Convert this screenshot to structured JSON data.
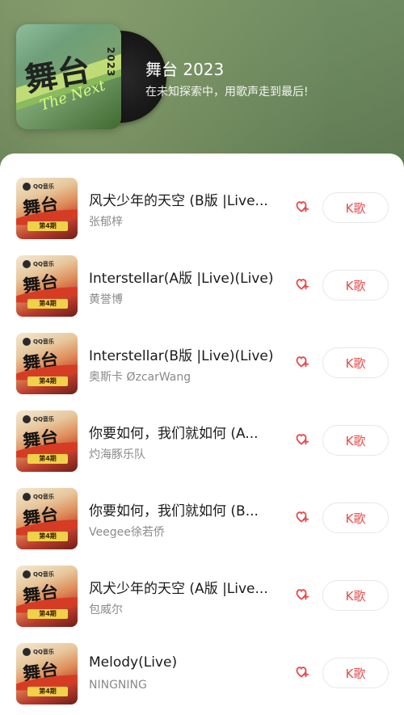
{
  "header": {
    "title": "舞台 2023",
    "subtitle": "在未知探索中，用歌声走到最后!",
    "cover_text": "舞台",
    "cover_script": "The Next",
    "cover_year": "2023"
  },
  "thumb_common": {
    "brand": "QQ音乐",
    "main": "舞台",
    "episode": "第4期"
  },
  "songs": [
    {
      "title": "风犬少年的天空 (B版 |Live...",
      "artist": "张郁梓",
      "k_label": "K歌"
    },
    {
      "title": "Interstellar(A版 |Live)(Live)",
      "artist": "黄誉博",
      "k_label": "K歌"
    },
    {
      "title": "Interstellar(B版 |Live)(Live)",
      "artist": "奥斯卡 ØzcarWang",
      "k_label": "K歌"
    },
    {
      "title": "你要如何，我们就如何 (A...",
      "artist": "灼海豚乐队",
      "k_label": "K歌"
    },
    {
      "title": "你要如何，我们就如何 (B...",
      "artist": "Veegee徐若侨",
      "k_label": "K歌"
    },
    {
      "title": "风犬少年的天空 (A版 |Live...",
      "artist": "包威尔",
      "k_label": "K歌"
    },
    {
      "title": "Melody(Live)",
      "artist": "NINGNING",
      "k_label": "K歌"
    }
  ],
  "colors": {
    "accent": "#e84b4b",
    "header_bg": "#4c6646"
  },
  "icons": {
    "add_to_playlist": "add-to-playlist-icon"
  }
}
